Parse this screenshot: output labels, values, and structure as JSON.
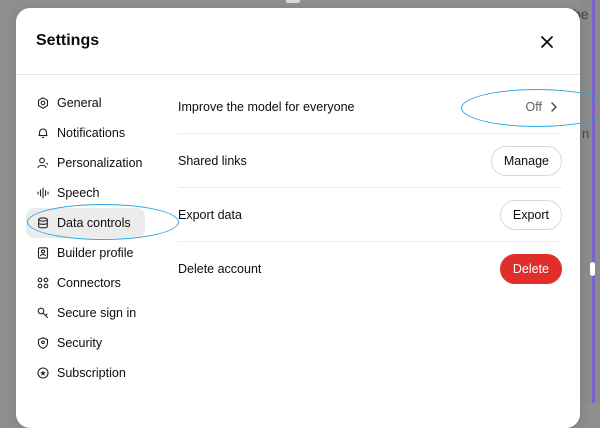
{
  "background": {
    "fragment_top": "be",
    "fragment_mid": "n"
  },
  "dialog": {
    "title": "Settings",
    "close_label": "×"
  },
  "sidebar": {
    "items": [
      {
        "label": "General",
        "icon": "gear-icon"
      },
      {
        "label": "Notifications",
        "icon": "bell-icon"
      },
      {
        "label": "Personalization",
        "icon": "person-icon"
      },
      {
        "label": "Speech",
        "icon": "waveform-icon"
      },
      {
        "label": "Data controls",
        "icon": "database-icon",
        "active": true
      },
      {
        "label": "Builder profile",
        "icon": "id-badge-icon"
      },
      {
        "label": "Connectors",
        "icon": "connectors-icon"
      },
      {
        "label": "Secure sign in",
        "icon": "key-icon"
      },
      {
        "label": "Security",
        "icon": "shield-icon"
      },
      {
        "label": "Subscription",
        "icon": "subscription-icon"
      }
    ]
  },
  "settings": {
    "improve_model": {
      "label": "Improve the model for everyone",
      "value": "Off"
    },
    "shared_links": {
      "label": "Shared links",
      "button": "Manage"
    },
    "export_data": {
      "label": "Export data",
      "button": "Export"
    },
    "delete_account": {
      "label": "Delete account",
      "button": "Delete"
    }
  },
  "colors": {
    "accent_ring": "#2ba5e3",
    "danger": "#e02e2a",
    "active_bg": "#ececec"
  }
}
